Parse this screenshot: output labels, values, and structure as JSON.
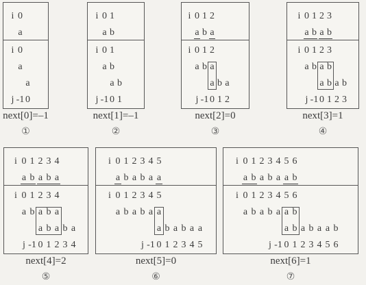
{
  "labels": {
    "i": "i",
    "j": "j"
  },
  "panels": [
    {
      "pattern": "a",
      "shift": 1,
      "top_underlines": [],
      "highlight": null,
      "j_values": [
        "-1",
        "0"
      ],
      "i_values": [
        "0"
      ],
      "caption": "next[0]=–1",
      "number": "①"
    },
    {
      "pattern": "ab",
      "shift": 1,
      "top_underlines": [],
      "highlight": null,
      "j_values": [
        "-1",
        "0",
        "1"
      ],
      "i_values": [
        "0",
        "1"
      ],
      "caption": "next[1]=–1",
      "number": "②"
    },
    {
      "pattern": "aba",
      "shift": 2,
      "top_underlines": [
        [
          0,
          0
        ],
        [
          2,
          2
        ]
      ],
      "highlight": [
        2,
        2
      ],
      "j_values": [
        "-1",
        "0",
        "1",
        "2"
      ],
      "i_values": [
        "0",
        "1",
        "2"
      ],
      "caption": "next[2]=0",
      "number": "③"
    },
    {
      "pattern": "abab",
      "shift": 2,
      "top_underlines": [
        [
          0,
          1
        ],
        [
          2,
          3
        ]
      ],
      "highlight": [
        2,
        3
      ],
      "j_values": [
        "-1",
        "0",
        "1",
        "2",
        "3"
      ],
      "i_values": [
        "0",
        "1",
        "2",
        "3"
      ],
      "caption": "next[3]=1",
      "number": "④"
    },
    {
      "pattern": "ababa",
      "shift": 2,
      "top_underlines": [
        [
          0,
          1
        ],
        [
          2,
          4
        ]
      ],
      "highlight": [
        2,
        4
      ],
      "j_values": [
        "-1",
        "0",
        "1",
        "2",
        "3",
        "4"
      ],
      "i_values": [
        "0",
        "1",
        "2",
        "3",
        "4"
      ],
      "caption": "next[4]=2",
      "number": "⑤"
    },
    {
      "pattern": "ababaa",
      "shift": 5,
      "top_underlines": [
        [
          0,
          0
        ],
        [
          5,
          5
        ]
      ],
      "highlight": [
        5,
        5
      ],
      "j_values": [
        "-1",
        "0",
        "1",
        "2",
        "3",
        "4",
        "5"
      ],
      "i_values": [
        "0",
        "1",
        "2",
        "3",
        "4",
        "5"
      ],
      "caption": "next[5]=0",
      "number": "⑥"
    },
    {
      "pattern": "ababaab",
      "shift": 5,
      "top_underlines": [
        [
          0,
          1
        ],
        [
          5,
          6
        ]
      ],
      "highlight": [
        5,
        6
      ],
      "j_values": [
        "-1",
        "0",
        "1",
        "2",
        "3",
        "4",
        "5",
        "6"
      ],
      "i_values": [
        "0",
        "1",
        "2",
        "3",
        "4",
        "5",
        "6"
      ],
      "caption": "next[6]=1",
      "number": "⑦"
    }
  ]
}
